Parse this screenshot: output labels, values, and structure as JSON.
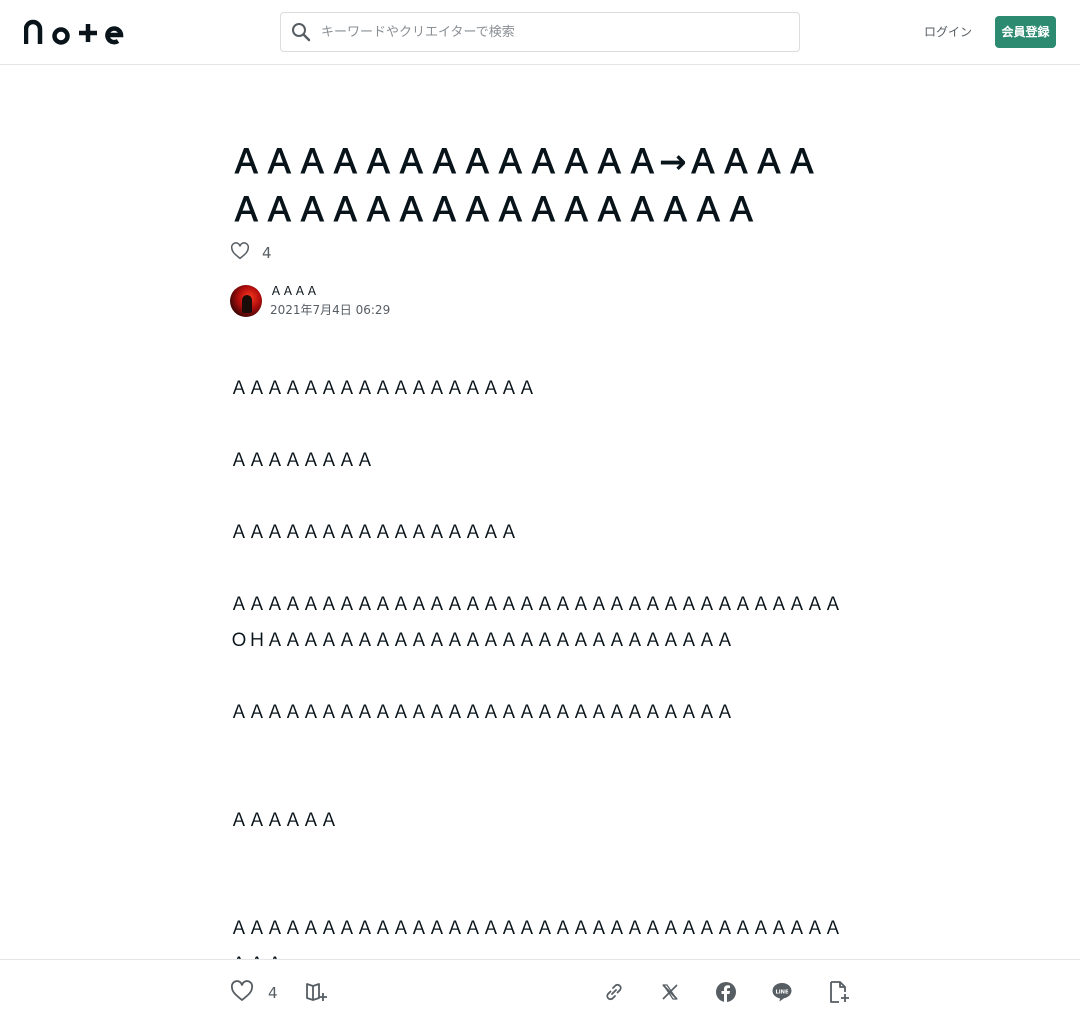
{
  "header": {
    "logo_text": "note",
    "search": {
      "placeholder": "キーワードやクリエイターで検索",
      "value": ""
    },
    "login_label": "ログイン",
    "signup_label": "会員登録"
  },
  "article": {
    "title": "ＡＡＡＡＡＡＡＡＡＡＡＡＡ→ＡＡＡＡＡＡＡＡＡＡＡＡＡＡＡＡＡＡＡＡ",
    "like_count": "4",
    "author": {
      "name": "ＡＡＡＡ",
      "date": "2021年7月4日 06:29"
    },
    "paragraphs": [
      "ＡＡＡＡＡＡＡＡＡＡＡＡＡＡＡＡＡ",
      "ＡＡＡＡＡＡＡＡ",
      "ＡＡＡＡＡＡＡＡＡＡＡＡＡＡＡＡ",
      "ＡＡＡＡＡＡＡＡＡＡＡＡＡＡＡＡＡＡＡＡＡＡＡＡＡＡＡＡＡＡＡＡＡＡＯＨＡＡＡＡＡＡＡＡＡＡＡＡＡＡＡＡＡＡＡＡＡＡＡＡＡＡ",
      "ＡＡＡＡＡＡＡＡＡＡＡＡＡＡＡＡＡＡＡＡＡＡＡＡＡＡＡＡ",
      "ＡＡＡＡＡＡ",
      "ＡＡＡＡＡＡＡＡＡＡＡＡＡＡＡＡＡＡＡＡＡＡＡＡＡＡＡＡＡＡＡＡＡＡＡＡＡ"
    ]
  },
  "bottom_bar": {
    "like_count": "4",
    "icons": [
      "heart-icon",
      "magazine-add-icon",
      "link-icon",
      "x-icon",
      "facebook-icon",
      "line-icon",
      "note-add-icon"
    ]
  },
  "colors": {
    "accent": "#2b8a6f",
    "text": "#08131a",
    "muted": "#565d63",
    "border": "#e6e6e6"
  }
}
